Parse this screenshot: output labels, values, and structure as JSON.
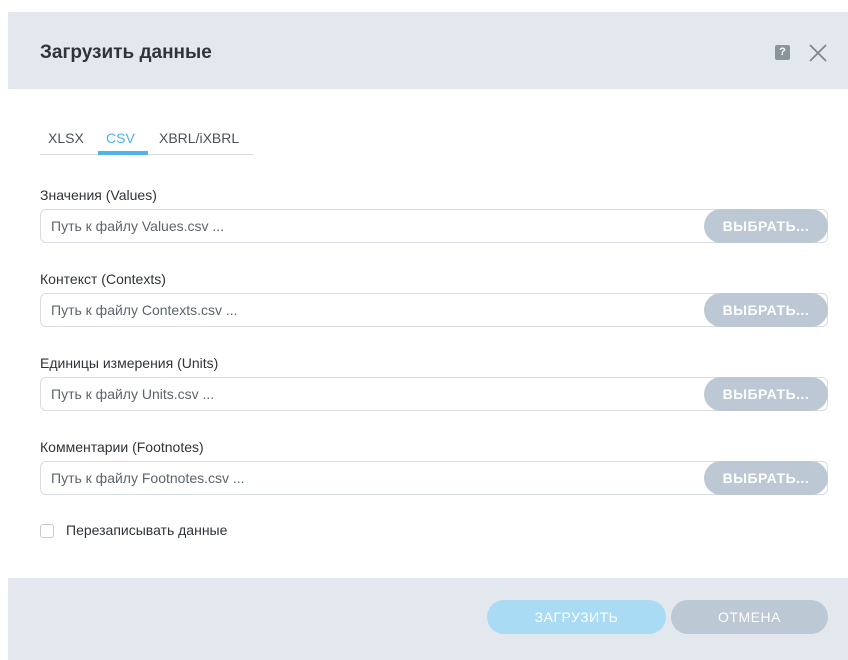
{
  "dialog": {
    "title": "Загрузить данные",
    "help_glyph": "?",
    "icons": [
      "help-icon",
      "close-icon"
    ]
  },
  "tabs": [
    {
      "label": "XLSX",
      "active": false
    },
    {
      "label": "CSV",
      "active": true
    },
    {
      "label": "XBRL/iXBRL",
      "active": false
    }
  ],
  "fields": [
    {
      "label": "Значения (Values)",
      "placeholder": "Путь к файлу Values.csv ...",
      "value": "",
      "button": "ВЫБРАТЬ..."
    },
    {
      "label": "Контекст (Contexts)",
      "placeholder": "Путь к файлу Contexts.csv ...",
      "value": "",
      "button": "ВЫБРАТЬ..."
    },
    {
      "label": "Единицы измерения (Units)",
      "placeholder": "Путь к файлу Units.csv ...",
      "value": "",
      "button": "ВЫБРАТЬ..."
    },
    {
      "label": "Комментарии (Footnotes)",
      "placeholder": "Путь к файлу Footnotes.csv ...",
      "value": "",
      "button": "ВЫБРАТЬ..."
    }
  ],
  "overwrite": {
    "label": "Перезаписывать данные",
    "checked": false
  },
  "footer": {
    "submit_label": "ЗАГРУЗИТЬ",
    "cancel_label": "ОТМЕНА"
  },
  "colors": {
    "accent": "#4fb4ea",
    "header_bg": "#e3e8ee",
    "button_disabled": "#bcc8d3",
    "submit_bg": "#a9dcf4"
  }
}
